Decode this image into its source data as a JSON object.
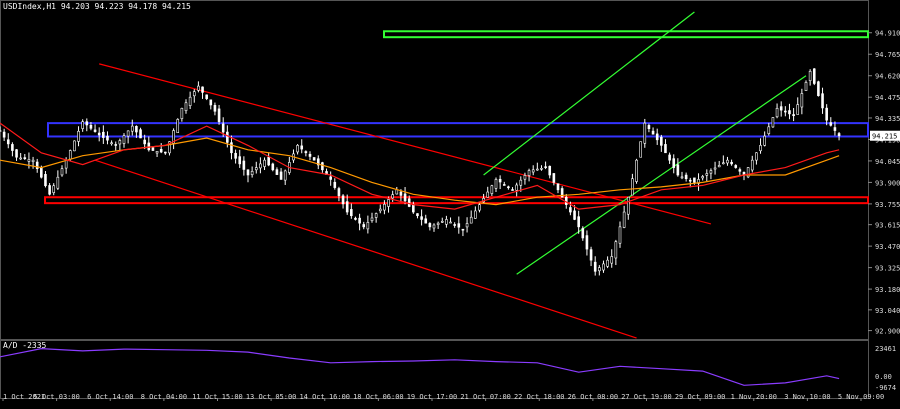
{
  "header": {
    "symbol": "USDIndex,H1",
    "ohlc": "94.203 94.223 94.178 94.215"
  },
  "indicator": {
    "label": "A/D -2335",
    "ticks": [
      "23461",
      "0.00",
      "-9674"
    ]
  },
  "colors": {
    "background": "#000000",
    "grid": "#2b2b2b",
    "candle": "#ffffff",
    "ma_fast": "#ff1a1a",
    "ma_slow": "#ff9900",
    "downtrend_channel": "#ff0000",
    "uptrend_channel": "#33ff33",
    "support_box": "#ff0000",
    "resistance_box": "#3333ff",
    "target_box": "#33ff33",
    "ad_line": "#8a3cff",
    "current_price_bg": "#ffffff"
  },
  "chart_data": {
    "type": "line",
    "title": "USDIndex,H1",
    "ylim": [
      92.85,
      95.05
    ],
    "y_ticks": [
      "94.910",
      "94.765",
      "94.620",
      "94.475",
      "94.335",
      "94.190",
      "94.045",
      "93.900",
      "93.755",
      "93.615",
      "93.470",
      "93.325",
      "93.180",
      "93.040",
      "92.900"
    ],
    "x_tick_labels": [
      "1 Oct 2021",
      "5 Oct 03:00",
      "6 Oct 14:00",
      "8 Oct 04:00",
      "11 Oct 15:00",
      "13 Oct 05:00",
      "14 Oct 16:00",
      "18 Oct 06:00",
      "19 Oct 17:00",
      "21 Oct 07:00",
      "22 Oct 18:00",
      "26 Oct 08:00",
      "27 Oct 19:00",
      "29 Oct 09:00",
      "1 Nov 20:00",
      "3 Nov 10:00",
      "5 Nov 09:00"
    ],
    "current_price": "94.215",
    "zones": [
      {
        "name": "target",
        "ymin": 94.88,
        "ymax": 94.92
      },
      {
        "name": "resistance",
        "ymin": 94.21,
        "ymax": 94.3
      },
      {
        "name": "support",
        "ymin": 93.76,
        "ymax": 93.8
      }
    ],
    "series": [
      {
        "name": "price",
        "x": [
          0,
          4,
          8,
          12,
          16,
          20,
          24,
          28,
          32,
          36,
          40,
          44,
          48,
          52,
          56,
          60,
          64,
          68,
          72,
          76,
          80,
          84,
          88,
          92,
          96,
          100,
          104,
          108,
          112,
          116,
          120,
          124,
          128,
          132,
          136,
          140,
          144,
          148,
          152,
          156,
          160,
          164,
          168,
          172,
          176,
          180,
          184,
          188,
          192,
          196,
          200,
          203
        ],
        "values": [
          94.25,
          94.07,
          94.05,
          93.82,
          94.05,
          94.31,
          94.22,
          94.15,
          94.28,
          94.12,
          94.1,
          94.4,
          94.55,
          94.38,
          94.1,
          93.95,
          94.05,
          93.92,
          94.15,
          94.05,
          93.92,
          93.7,
          93.6,
          93.72,
          93.85,
          93.7,
          93.6,
          93.65,
          93.58,
          93.75,
          93.92,
          93.85,
          93.98,
          94.0,
          93.8,
          93.6,
          93.3,
          93.4,
          93.8,
          94.3,
          94.15,
          93.95,
          93.9,
          93.98,
          94.05,
          93.95,
          94.15,
          94.4,
          94.35,
          94.65,
          94.32,
          94.215
        ]
      },
      {
        "name": "ma_fast",
        "x": [
          0,
          10,
          20,
          30,
          40,
          50,
          60,
          70,
          80,
          90,
          100,
          110,
          120,
          130,
          140,
          150,
          160,
          170,
          180,
          190,
          200,
          203
        ],
        "values": [
          94.3,
          94.1,
          94.02,
          94.12,
          94.15,
          94.28,
          94.15,
          94.0,
          93.95,
          93.82,
          93.75,
          93.72,
          93.8,
          93.88,
          93.72,
          93.75,
          93.85,
          93.88,
          93.95,
          94.0,
          94.1,
          94.12
        ]
      },
      {
        "name": "ma_slow",
        "x": [
          0,
          10,
          20,
          30,
          40,
          50,
          60,
          70,
          80,
          90,
          100,
          110,
          120,
          130,
          140,
          150,
          160,
          170,
          180,
          190,
          200,
          203
        ],
        "values": [
          94.05,
          94.0,
          94.08,
          94.12,
          94.15,
          94.2,
          94.12,
          94.08,
          94.0,
          93.9,
          93.82,
          93.78,
          93.75,
          93.8,
          93.82,
          93.85,
          93.87,
          93.9,
          93.95,
          93.95,
          94.05,
          94.08
        ]
      },
      {
        "name": "ad",
        "x": [
          0,
          10,
          20,
          30,
          40,
          50,
          60,
          70,
          80,
          90,
          100,
          110,
          120,
          130,
          140,
          150,
          160,
          170,
          180,
          190,
          200,
          203
        ],
        "values": [
          16000,
          23000,
          21000,
          22500,
          22000,
          21500,
          20000,
          15000,
          11000,
          12000,
          12500,
          13500,
          12000,
          11000,
          3000,
          8000,
          6000,
          4000,
          -8000,
          -6000,
          0,
          -2335
        ]
      }
    ],
    "trendlines": [
      {
        "name": "downtrend_channel_upper",
        "x": [
          24,
          172
        ],
        "y": [
          94.7,
          93.62
        ]
      },
      {
        "name": "downtrend_channel_lower",
        "x": [
          23,
          154
        ],
        "y": [
          94.05,
          92.85
        ]
      },
      {
        "name": "uptrend_channel_lower",
        "x": [
          125,
          195
        ],
        "y": [
          93.28,
          94.62
        ]
      },
      {
        "name": "uptrend_channel_upper",
        "x": [
          117,
          168
        ],
        "y": [
          93.95,
          95.05
        ]
      }
    ],
    "ad_ylim": [
      -12000,
      26000
    ]
  }
}
